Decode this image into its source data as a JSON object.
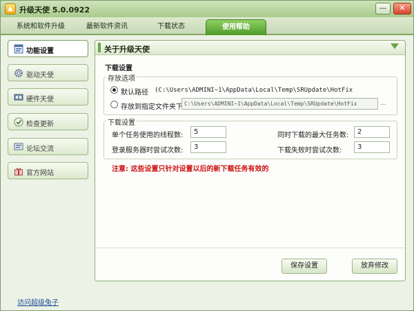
{
  "window": {
    "title": "升级天使 5.0.0922",
    "minimize_glyph": "—",
    "close_glyph": "✕"
  },
  "tabs": [
    {
      "label": "系统和软件升级"
    },
    {
      "label": "最新软件资讯"
    },
    {
      "label": "下载状态"
    },
    {
      "label": "使用帮助"
    }
  ],
  "sidebar": {
    "items": [
      {
        "label": "功能设置",
        "icon": "settings-window-icon"
      },
      {
        "label": "驱动天使",
        "icon": "gear-icon"
      },
      {
        "label": "硬件天使",
        "icon": "hardware-icon"
      },
      {
        "label": "检查更新",
        "icon": "update-icon"
      },
      {
        "label": "论坛交流",
        "icon": "forum-icon"
      },
      {
        "label": "官方网站",
        "icon": "gift-icon"
      }
    ],
    "bottom_link": "访问超级兔子"
  },
  "panel": {
    "title": "关于升级天使",
    "section_title": "下载设置",
    "storage": {
      "legend": "存放选项",
      "default_label": "默认路径",
      "default_path": "(C:\\Users\\ADMINI~1\\AppData\\Local\\Temp\\SRUpdate\\HotFix",
      "custom_label": "存放到指定文件夹下",
      "custom_path": "C:\\Users\\ADMINI~1\\AppData\\Local\\Temp\\SRUpdate\\HotFix",
      "browse_label": "..."
    },
    "download": {
      "legend": "下载设置",
      "threads_label": "单个任务使用的线程数:",
      "threads_value": "5",
      "max_tasks_label": "同时下载的最大任务数:",
      "max_tasks_value": "2",
      "login_retry_label": "登录服务器时尝试次数:",
      "login_retry_value": "3",
      "fail_retry_label": "下载失败时尝试次数:",
      "fail_retry_value": "3"
    },
    "note": "注意: 这些设置只针对设置以后的新下载任务有效的",
    "save_button": "保存设置",
    "discard_button": "放弃修改"
  }
}
